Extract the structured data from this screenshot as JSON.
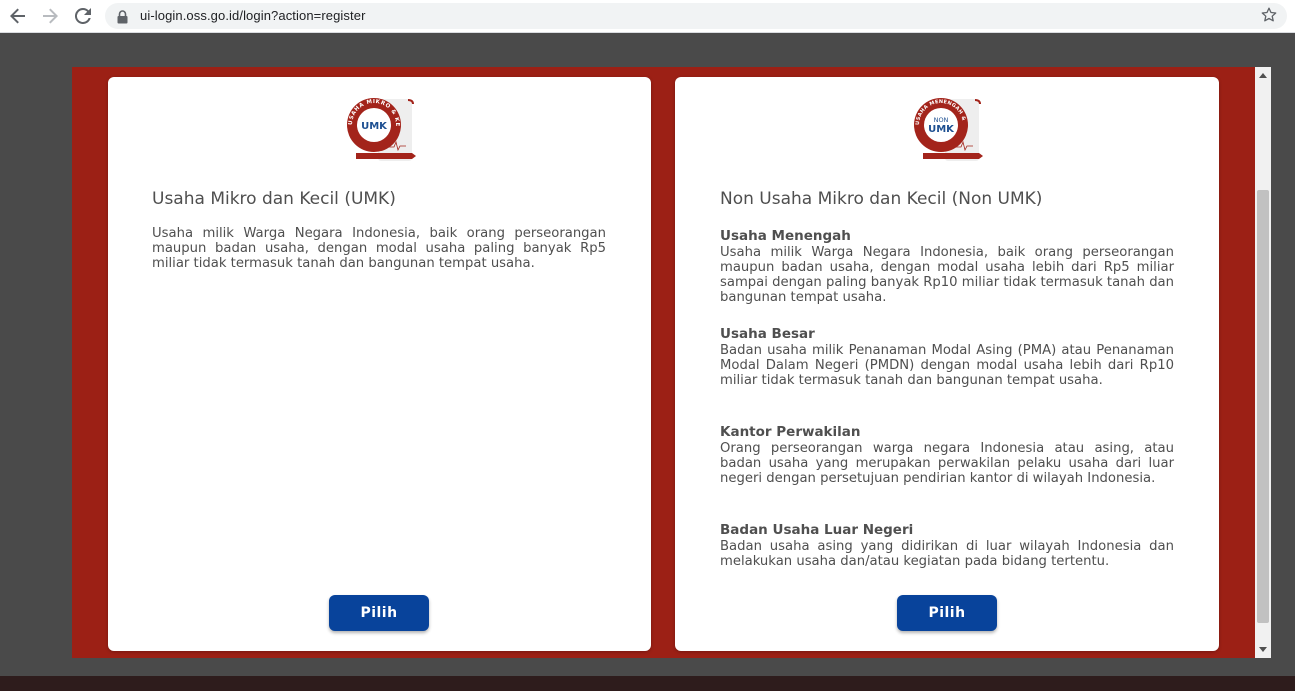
{
  "browser": {
    "url": "ui-login.oss.go.id/login?action=register"
  },
  "cards": {
    "umk": {
      "logo_text": "UMK",
      "logo_ring_text": "USAHA MIKRO & KECIL",
      "title": "Usaha Mikro dan Kecil (UMK)",
      "description": "Usaha milik Warga Negara Indonesia, baik orang perseorangan maupun badan usaha, dengan modal usaha paling banyak Rp5 miliar tidak termasuk tanah dan bangunan tempat usaha.",
      "button_label": "Pilih"
    },
    "non_umk": {
      "logo_text_top": "NON",
      "logo_text_bottom": "UMK",
      "logo_ring_text": "USAHA MENENGAH & BESAR",
      "title": "Non Usaha Mikro dan Kecil (Non UMK)",
      "sections": [
        {
          "title": "Usaha Menengah",
          "text": "Usaha milik Warga Negara Indonesia, baik orang perseorangan maupun badan usaha, dengan modal usaha lebih dari Rp5 miliar sampai dengan paling banyak Rp10 miliar tidak termasuk tanah dan bangunan tempat usaha."
        },
        {
          "title": "Usaha Besar",
          "text": "Badan usaha milik Penanaman Modal Asing (PMA) atau Penanaman Modal Dalam Negeri (PMDN) dengan modal usaha lebih dari Rp10 miliar tidak termasuk tanah dan bangunan tempat usaha."
        },
        {
          "title": "Kantor Perwakilan",
          "text": "Orang perseorangan warga negara Indonesia atau asing, atau badan usaha yang merupakan perwakilan pelaku usaha dari luar negeri dengan persetujuan pendirian kantor di wilayah Indonesia."
        },
        {
          "title": "Badan Usaha Luar Negeri",
          "text": "Badan usaha asing yang didirikan di luar wilayah Indonesia dan melakukan usaha dan/atau kegiatan pada bidang tertentu."
        }
      ],
      "button_label": "Pilih"
    }
  },
  "colors": {
    "modal_bg": "#9c2015",
    "button_bg": "#08439b",
    "logo_red": "#a3241b",
    "logo_blue": "#1d4f91"
  },
  "icons": {
    "back": "back-arrow-icon",
    "forward": "forward-arrow-icon",
    "reload": "reload-icon",
    "lock": "lock-icon",
    "bookmark": "star-icon"
  }
}
